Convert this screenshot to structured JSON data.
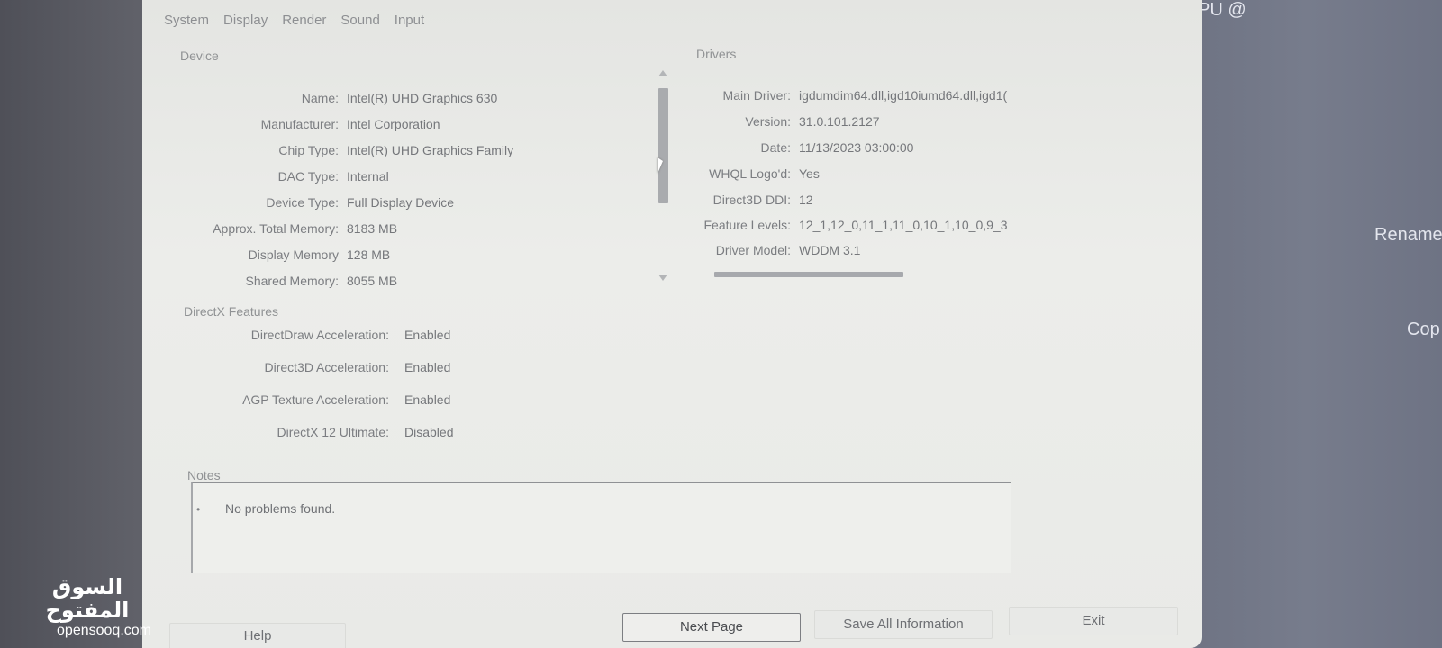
{
  "background": {
    "top_fragment": "PU @",
    "right_items": [
      "Rename",
      "Cop"
    ]
  },
  "tabs": [
    "System",
    "Display",
    "Render",
    "Sound",
    "Input"
  ],
  "device": {
    "group_label": "Device",
    "rows": [
      {
        "label": "Name:",
        "value": "Intel(R) UHD Graphics 630"
      },
      {
        "label": "Manufacturer:",
        "value": "Intel Corporation"
      },
      {
        "label": "Chip Type:",
        "value": "Intel(R) UHD Graphics Family"
      },
      {
        "label": "DAC Type:",
        "value": "Internal"
      },
      {
        "label": "Device Type:",
        "value": "Full Display Device"
      },
      {
        "label": "Approx. Total Memory:",
        "value": "8183 MB"
      },
      {
        "label": "Display Memory",
        "value": "128 MB"
      },
      {
        "label": "Shared Memory:",
        "value": "8055 MB"
      }
    ]
  },
  "drivers": {
    "group_label": "Drivers",
    "rows": [
      {
        "label": "Main Driver:",
        "value": "igdumdim64.dll,igd10iumd64.dll,igd1("
      },
      {
        "label": "Version:",
        "value": "31.0.101.2127"
      },
      {
        "label": "Date:",
        "value": "11/13/2023 03:00:00"
      },
      {
        "label": "WHQL Logo'd:",
        "value": "Yes"
      },
      {
        "label": "Direct3D DDI:",
        "value": "12"
      },
      {
        "label": "Feature Levels:",
        "value": "12_1,12_0,11_1,11_0,10_1,10_0,9_3"
      },
      {
        "label": "Driver Model:",
        "value": "WDDM 3.1"
      }
    ]
  },
  "directx": {
    "group_label": "DirectX Features",
    "rows": [
      {
        "label": "DirectDraw Acceleration:",
        "value": "Enabled"
      },
      {
        "label": "Direct3D Acceleration:",
        "value": "Enabled"
      },
      {
        "label": "AGP Texture Acceleration:",
        "value": "Enabled"
      },
      {
        "label": "DirectX 12 Ultimate:",
        "value": "Disabled"
      }
    ]
  },
  "notes": {
    "group_label": "Notes",
    "bullet": "•",
    "items": [
      "No problems found."
    ]
  },
  "buttons": {
    "help": "Help",
    "next_page": "Next Page",
    "save_all": "Save All Information",
    "exit": "Exit"
  },
  "watermark": {
    "arabic": "السوق المفتوح",
    "latin": "opensooq.com"
  }
}
